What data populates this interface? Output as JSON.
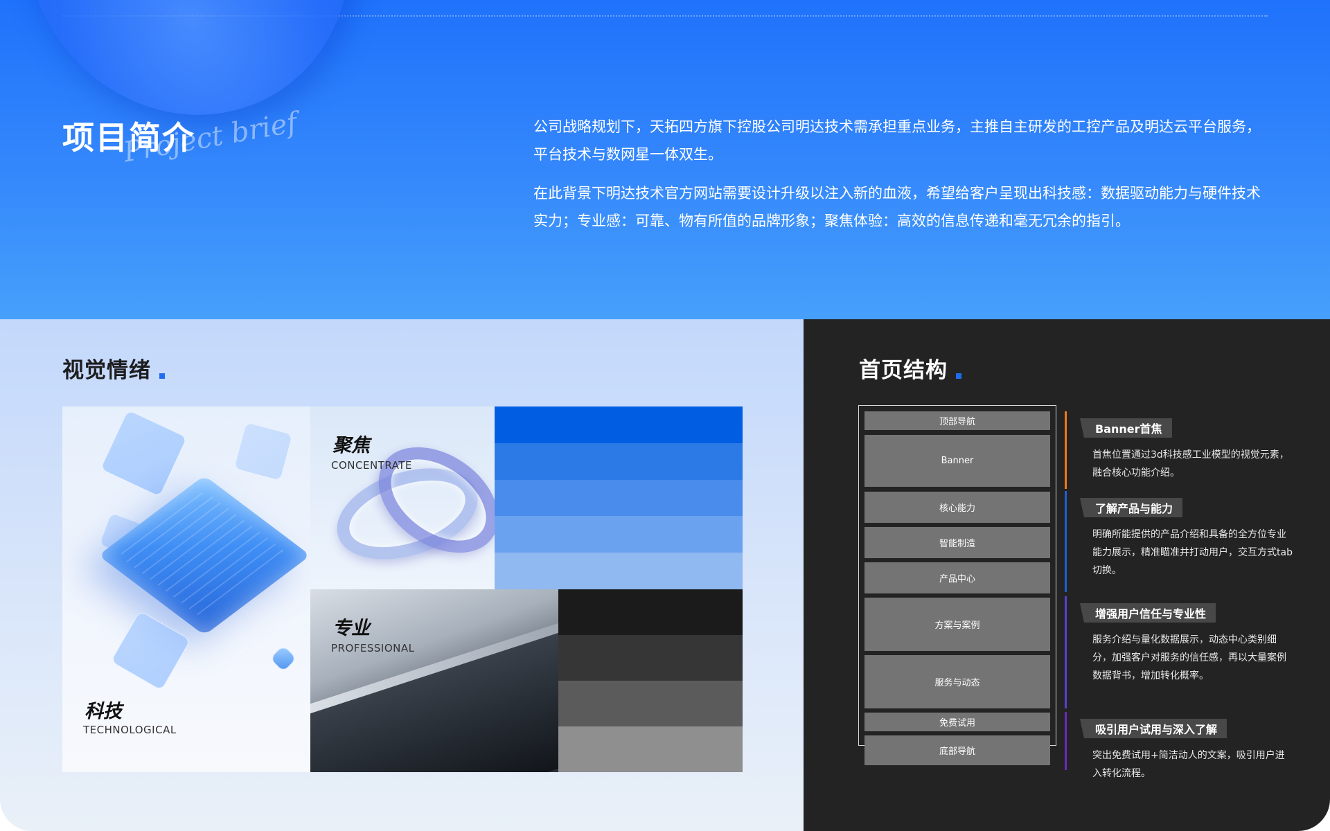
{
  "hero": {
    "title": "项目简介",
    "script_subtitle": "Project brief",
    "paragraphs": [
      "公司战略规划下，天拓四方旗下控股公司明达技术需承担重点业务，主推自主研发的工控产品及明达云平台服务， 平台技术与数网星一体双生。",
      "在此背景下明达技术官方网站需要设计升级以注入新的血液，希望给客户呈现出科技感：数据驱动能力与硬件技术实力；专业感：可靠、物有所值的品牌形象；聚焦体验：高效的信息传递和毫无冗余的指引。"
    ]
  },
  "visual": {
    "title": "视觉情绪",
    "tiles": {
      "tech": {
        "cn": "科技",
        "en": "TECHNOLOGICAL"
      },
      "focus": {
        "cn": "聚焦",
        "en": "CONCENTRATE"
      },
      "pro": {
        "cn": "专业",
        "en": "PROFESSIONAL"
      }
    },
    "blue_swatches": [
      "#015ee2",
      "#2c7ae6",
      "#4a8ceb",
      "#6aa2ef",
      "#90b8f1"
    ],
    "gray_swatches": [
      "#1b1b1b",
      "#363636",
      "#5b5b5b",
      "#8f8f8f"
    ],
    "accent_color": "#1f6cf0"
  },
  "structure": {
    "title": "首页结构",
    "wireframe": [
      "顶部导航",
      "Banner",
      "核心能力",
      "智能制造",
      "产品中心",
      "方案与案例",
      "服务与动态",
      "免费试用",
      "底部导航"
    ],
    "annotations": [
      {
        "tag": "Banner首焦",
        "desc": "首焦位置通过3d科技感工业模型的视觉元素，融合核心功能介绍。",
        "color": "#f07a1a"
      },
      {
        "tag": "了解产品与能力",
        "desc": "明确所能提供的产品介绍和具备的全方位专业能力展示，精准瞄准并打动用户，交互方式tab切换。",
        "color": "#1e5fd8"
      },
      {
        "tag": "增强用户信任与专业性",
        "desc": "服务介绍与量化数据展示，动态中心类别细分，加强客户对服务的信任感，再以大量案例数据背书，增加转化概率。",
        "color": "#5b3fd0"
      },
      {
        "tag": "吸引用户试用与深入了解",
        "desc": "突出免费试用+简洁动人的文案，吸引用户进入转化流程。",
        "color": "#6a2ab8"
      }
    ]
  }
}
